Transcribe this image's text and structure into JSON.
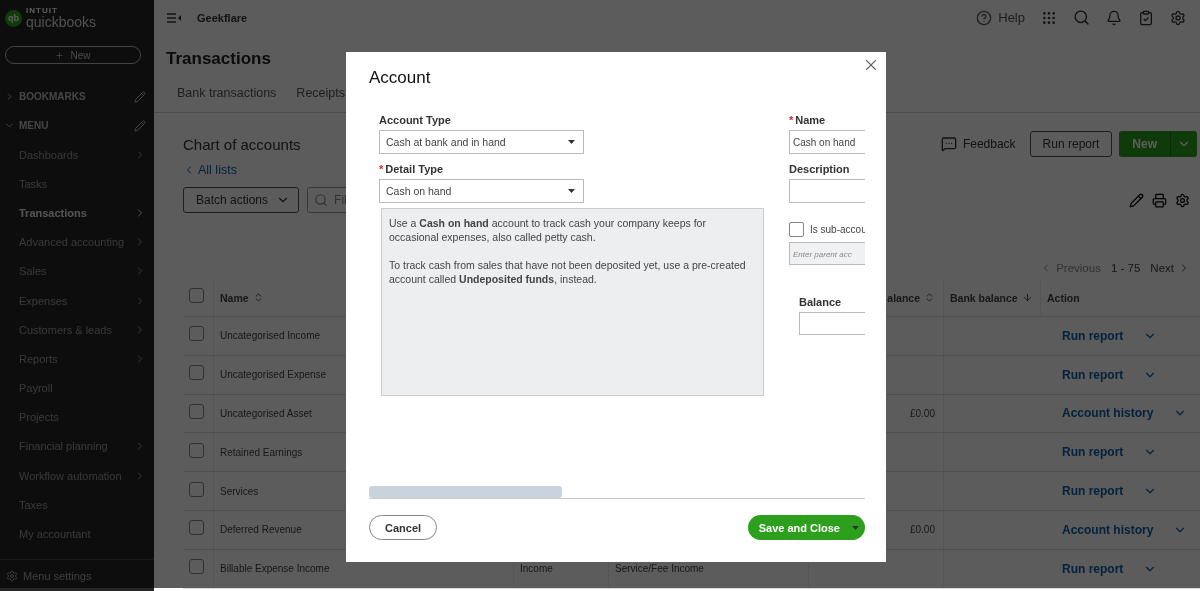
{
  "sidebar": {
    "brand_small": "INTUIT",
    "brand_name": "quickbooks",
    "logo_letters": "qb",
    "new_button": "New",
    "sections": [
      {
        "label": "BOOKMARKS",
        "expanded": false
      },
      {
        "label": "MENU",
        "expanded": true
      }
    ],
    "items": [
      {
        "label": "Dashboards",
        "has_submenu": true,
        "selected": false
      },
      {
        "label": "Tasks",
        "has_submenu": false,
        "selected": false
      },
      {
        "label": "Transactions",
        "has_submenu": true,
        "selected": true
      },
      {
        "label": "Advanced accounting",
        "has_submenu": true,
        "selected": false
      },
      {
        "label": "Sales",
        "has_submenu": true,
        "selected": false
      },
      {
        "label": "Expenses",
        "has_submenu": true,
        "selected": false
      },
      {
        "label": "Customers & leads",
        "has_submenu": true,
        "selected": false
      },
      {
        "label": "Reports",
        "has_submenu": true,
        "selected": false
      },
      {
        "label": "Payroll",
        "has_submenu": false,
        "selected": false
      },
      {
        "label": "Projects",
        "has_submenu": false,
        "selected": false
      },
      {
        "label": "Financial planning",
        "has_submenu": true,
        "selected": false
      },
      {
        "label": "Workflow automation",
        "has_submenu": true,
        "selected": false
      },
      {
        "label": "Taxes",
        "has_submenu": false,
        "selected": false
      },
      {
        "label": "My accountant",
        "has_submenu": false,
        "selected": false
      }
    ],
    "footer": "Menu settings"
  },
  "top_bar": {
    "company": "Geekflare",
    "help": "Help"
  },
  "page": {
    "title": "Transactions",
    "tabs": [
      {
        "label": "Bank transactions",
        "selected": false
      },
      {
        "label": "Receipts",
        "selected": false
      }
    ]
  },
  "chart_of_accounts": {
    "title": "Chart of accounts",
    "back_link": "All lists",
    "batch_button": "Batch actions",
    "filter_placeholder": "Fil",
    "feedback": "Feedback",
    "run_report": "Run report",
    "new_button": "New",
    "pagination": {
      "previous": "Previous",
      "previous_disabled": true,
      "range": "1 - 75",
      "next": "Next"
    },
    "select_all_checked": false,
    "columns": [
      {
        "label": "Name",
        "sortable": true,
        "sorted": false
      },
      {
        "label": "alance",
        "sortable": true,
        "sorted": false
      },
      {
        "label": "Bank balance",
        "sortable": true,
        "sorted": true
      },
      {
        "label": "Action",
        "sortable": false
      }
    ],
    "rows": [
      {
        "checked": false,
        "name": "Uncategorised Income",
        "action": "Run report"
      },
      {
        "checked": false,
        "name": "Uncategorised Expense",
        "action": "Run report"
      },
      {
        "checked": false,
        "name": "Uncategorised Asset",
        "balance": "£0.00",
        "action": "Account history"
      },
      {
        "checked": false,
        "name": "Retained Earnings",
        "action": "Run report"
      },
      {
        "checked": false,
        "name": "Services",
        "action": "Run report"
      },
      {
        "checked": false,
        "name": "Deferred Revenue",
        "balance": "£0.00",
        "action": "Account history"
      },
      {
        "checked": false,
        "name": "Billable Expense Income",
        "type": "Income",
        "detail_type": "Service/Fee Income",
        "action": "Run report"
      }
    ]
  },
  "dialog": {
    "title": "Account",
    "account_type": {
      "label": "Account Type",
      "value": "Cash at bank and in hand"
    },
    "detail_type": {
      "label": "Detail Type",
      "required_mark": "*",
      "value": "Cash on hand"
    },
    "info": [
      "Use a **Cash on hand** account to track cash your company keeps for occasional expenses, also called petty cash.",
      "To track cash from sales that have not been deposited yet, use a pre-created account called **Undeposited funds**, instead."
    ],
    "name": {
      "label": "Name",
      "required_mark": "*",
      "value": "Cash on hand"
    },
    "description": {
      "label": "Description"
    },
    "sub_account": {
      "label": "Is sub-accou",
      "checked": false,
      "placeholder": "Enter parent acc"
    },
    "balance": {
      "label": "Balance"
    },
    "cancel": "Cancel",
    "save": "Save and Close"
  }
}
